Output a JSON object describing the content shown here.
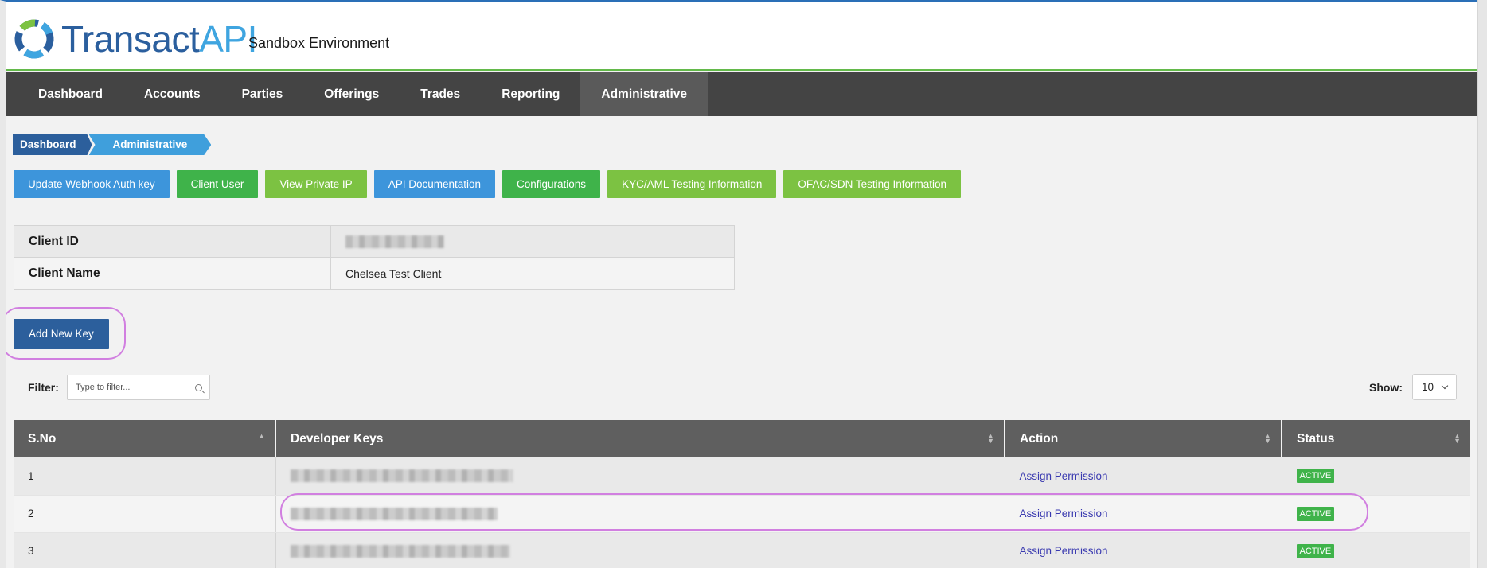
{
  "header": {
    "logo_text_part1": "Transact",
    "logo_text_part2": "API",
    "environment": "Sandbox Environment"
  },
  "nav": {
    "items": [
      {
        "label": "Dashboard"
      },
      {
        "label": "Accounts"
      },
      {
        "label": "Parties"
      },
      {
        "label": "Offerings"
      },
      {
        "label": "Trades"
      },
      {
        "label": "Reporting"
      },
      {
        "label": "Administrative",
        "active": true
      }
    ]
  },
  "breadcrumb": [
    "Dashboard",
    "Administrative"
  ],
  "actions": [
    {
      "label": "Update Webhook Auth key",
      "color": "#3d95db"
    },
    {
      "label": "Client User",
      "color": "#3fb34a"
    },
    {
      "label": "View Private IP",
      "color": "#7cc242"
    },
    {
      "label": "API Documentation",
      "color": "#3d95db"
    },
    {
      "label": "Configurations",
      "color": "#3fb34a"
    },
    {
      "label": "KYC/AML Testing Information",
      "color": "#7cc242"
    },
    {
      "label": "OFAC/SDN Testing Information",
      "color": "#7cc242"
    }
  ],
  "client": {
    "id_label": "Client ID",
    "name_label": "Client Name",
    "name_value": "Chelsea Test Client"
  },
  "add_key_label": "Add New Key",
  "filter": {
    "label": "Filter:",
    "placeholder": "Type to filter..."
  },
  "show": {
    "label": "Show:",
    "value": "10"
  },
  "keys_table": {
    "columns": [
      "S.No",
      "Developer Keys",
      "Action",
      "Status"
    ],
    "rows": [
      {
        "sno": "1",
        "action": "Assign Permission",
        "status": "ACTIVE"
      },
      {
        "sno": "2",
        "action": "Assign Permission",
        "status": "ACTIVE"
      },
      {
        "sno": "3",
        "action": "Assign Permission",
        "status": "ACTIVE"
      }
    ]
  },
  "colors": {
    "brand_dark": "#2c5f9c",
    "brand_light": "#3fa5e0",
    "nav_bg": "#444444",
    "success": "#3fb34a",
    "highlight": "#d17fe0"
  }
}
